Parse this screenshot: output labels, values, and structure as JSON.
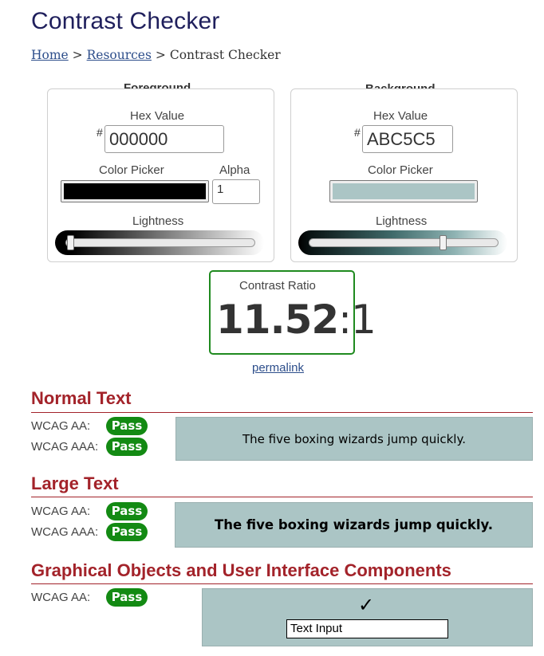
{
  "page": {
    "title": "Contrast Checker"
  },
  "breadcrumb": {
    "home": "Home",
    "sep1": ">",
    "resources": "Resources",
    "sep2": ">",
    "current": "Contrast Checker"
  },
  "foreground": {
    "heading": "Foreground",
    "hex_label": "Hex Value",
    "hash": "#",
    "hex_value": "000000",
    "picker_label": "Color Picker",
    "alpha_label": "Alpha",
    "alpha_value": "1",
    "lightness_label": "Lightness",
    "color": "#000000",
    "lightness_fraction": 0.0
  },
  "background": {
    "heading": "Background",
    "hex_label": "Hex Value",
    "hash": "#",
    "hex_value": "ABC5C5",
    "picker_label": "Color Picker",
    "lightness_label": "Lightness",
    "color": "#ABC5C5",
    "lightness_fraction": 0.7
  },
  "ratio": {
    "label": "Contrast Ratio",
    "value": "11.52",
    "suffix": ":1",
    "permalink": "permalink"
  },
  "normal_text": {
    "heading": "Normal Text",
    "aa_label": "WCAG AA:",
    "aa_result": "Pass",
    "aaa_label": "WCAG AAA:",
    "aaa_result": "Pass",
    "sample": "The five boxing wizards jump quickly."
  },
  "large_text": {
    "heading": "Large Text",
    "aa_label": "WCAG AA:",
    "aa_result": "Pass",
    "aaa_label": "WCAG AAA:",
    "aaa_result": "Pass",
    "sample": "The five boxing wizards jump quickly."
  },
  "graphical": {
    "heading": "Graphical Objects and User Interface Components",
    "aa_label": "WCAG AA:",
    "aa_result": "Pass",
    "checkmark": "✓",
    "input_text": "Text Input"
  },
  "colors": {
    "pass_green": "#138a13",
    "section_red": "#a3232a",
    "title_navy": "#1f1f5c",
    "link_blue": "#2d4e8b"
  }
}
